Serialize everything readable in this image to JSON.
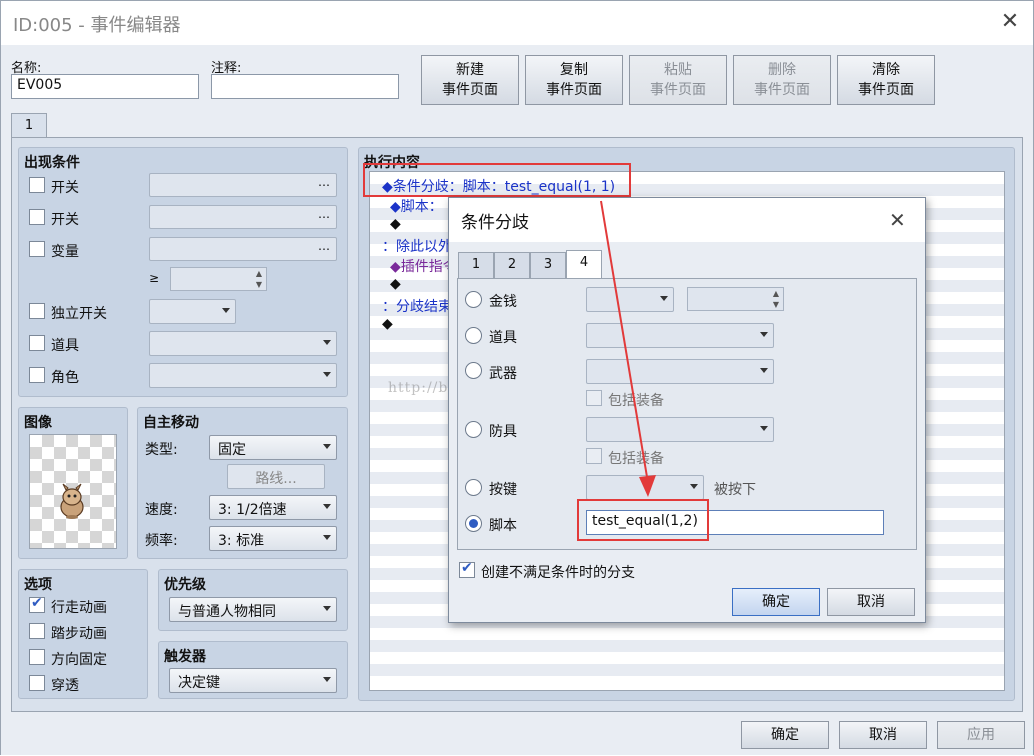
{
  "window": {
    "title": "ID:005 - 事件编辑器"
  },
  "fields": {
    "name_label": "名称:",
    "name_value": "EV005",
    "note_label": "注释:",
    "note_value": ""
  },
  "toolbar": [
    {
      "line1": "新建",
      "line2": "事件页面",
      "enabled": true
    },
    {
      "line1": "复制",
      "line2": "事件页面",
      "enabled": true
    },
    {
      "line1": "粘贴",
      "line2": "事件页面",
      "enabled": false
    },
    {
      "line1": "删除",
      "line2": "事件页面",
      "enabled": false
    },
    {
      "line1": "清除",
      "line2": "事件页面",
      "enabled": true
    }
  ],
  "page_tabs": [
    "1"
  ],
  "conditions": {
    "title": "出现条件",
    "items": [
      "开关",
      "开关",
      "变量",
      "独立开关",
      "道具",
      "角色"
    ],
    "ge_symbol": "≥",
    "dots": "…"
  },
  "image": {
    "title": "图像"
  },
  "autonomous": {
    "title": "自主移动",
    "type_label": "类型:",
    "type_value": "固定",
    "route_button": "路线...",
    "speed_label": "速度:",
    "speed_value": "3: 1/2倍速",
    "freq_label": "频率:",
    "freq_value": "3: 标准"
  },
  "options": {
    "title": "选项",
    "items": [
      {
        "label": "行走动画",
        "checked": true
      },
      {
        "label": "踏步动画",
        "checked": false
      },
      {
        "label": "方向固定",
        "checked": false
      },
      {
        "label": "穿透",
        "checked": false
      }
    ]
  },
  "priority": {
    "title": "优先级",
    "value": "与普通人物相同"
  },
  "trigger": {
    "title": "触发器",
    "value": "决定键"
  },
  "contents": {
    "title": "执行内容",
    "lines": [
      "◆条件分歧：脚本：test_equal(1, 1)",
      "◆脚本：",
      "◆",
      "：除此以外",
      "◆插件指令",
      "◆",
      "：分歧结束",
      "◆"
    ],
    "watermark": "http://blog.csdn.net/shaoyun"
  },
  "footer": {
    "ok": "确定",
    "cancel": "取消",
    "apply": "应用"
  },
  "dialog": {
    "title": "条件分歧",
    "tabs": [
      "1",
      "2",
      "3",
      "4"
    ],
    "active_tab": "4",
    "rows": [
      {
        "label": "金钱",
        "selected": false
      },
      {
        "label": "道具",
        "selected": false
      },
      {
        "label": "武器",
        "selected": false
      },
      {
        "label": "防具",
        "selected": false
      },
      {
        "label": "按键",
        "selected": false
      },
      {
        "label": "脚本",
        "selected": true
      }
    ],
    "include_equip": "包括装备",
    "pressed_label": "被按下",
    "script_value": "test_equal(1,2)",
    "else_branch_label": "创建不满足条件时的分支",
    "else_branch_checked": true,
    "ok": "确定",
    "cancel": "取消"
  },
  "colors": {
    "accent": "#2f5cc2",
    "annotation": "#e23a3a",
    "command_text": "#1b33c8",
    "plugin_text": "#7a2a9a"
  }
}
